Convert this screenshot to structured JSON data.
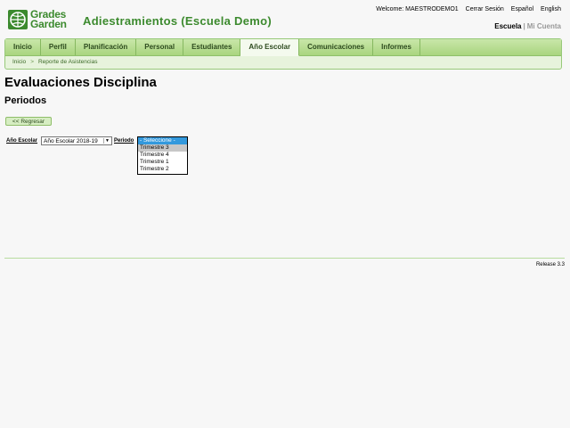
{
  "logo": {
    "line1": "Grades",
    "line2": "Garden"
  },
  "app_title": "Adiestramientos (Escuela Demo)",
  "top_links": {
    "welcome": "Welcome: MAESTRODEMO1",
    "logout": "Cerrar Sesión",
    "spanish": "Español",
    "english": "English"
  },
  "scope": {
    "school": "Escuela",
    "account": "Mi Cuenta"
  },
  "tabs": [
    {
      "label": "Inicio"
    },
    {
      "label": "Perfil"
    },
    {
      "label": "Planificación"
    },
    {
      "label": "Personal"
    },
    {
      "label": "Estudiantes"
    },
    {
      "label": "Año Escolar"
    },
    {
      "label": "Comunicaciones"
    },
    {
      "label": "Informes"
    }
  ],
  "breadcrumb": {
    "home": "Inicio",
    "separator": ">",
    "current": "Reporte de Asistencias"
  },
  "page_title": "Evaluaciones Disciplina",
  "section_title": "Periodos",
  "back_button": "<< Regresar",
  "filters": {
    "year_label": "Año Escolar",
    "year_value": "Año Escolar 2018-19",
    "period_label": "Periodo",
    "period_options": [
      "- Seleccione -",
      "Trimestre 3",
      "Trimestre 4",
      "Trimestre 1",
      "Trimestre 2"
    ]
  },
  "footer": {
    "release": "Release 3.3"
  },
  "colors": {
    "brand_green": "#3c8a2e",
    "selected_blue": "#3399dd"
  }
}
